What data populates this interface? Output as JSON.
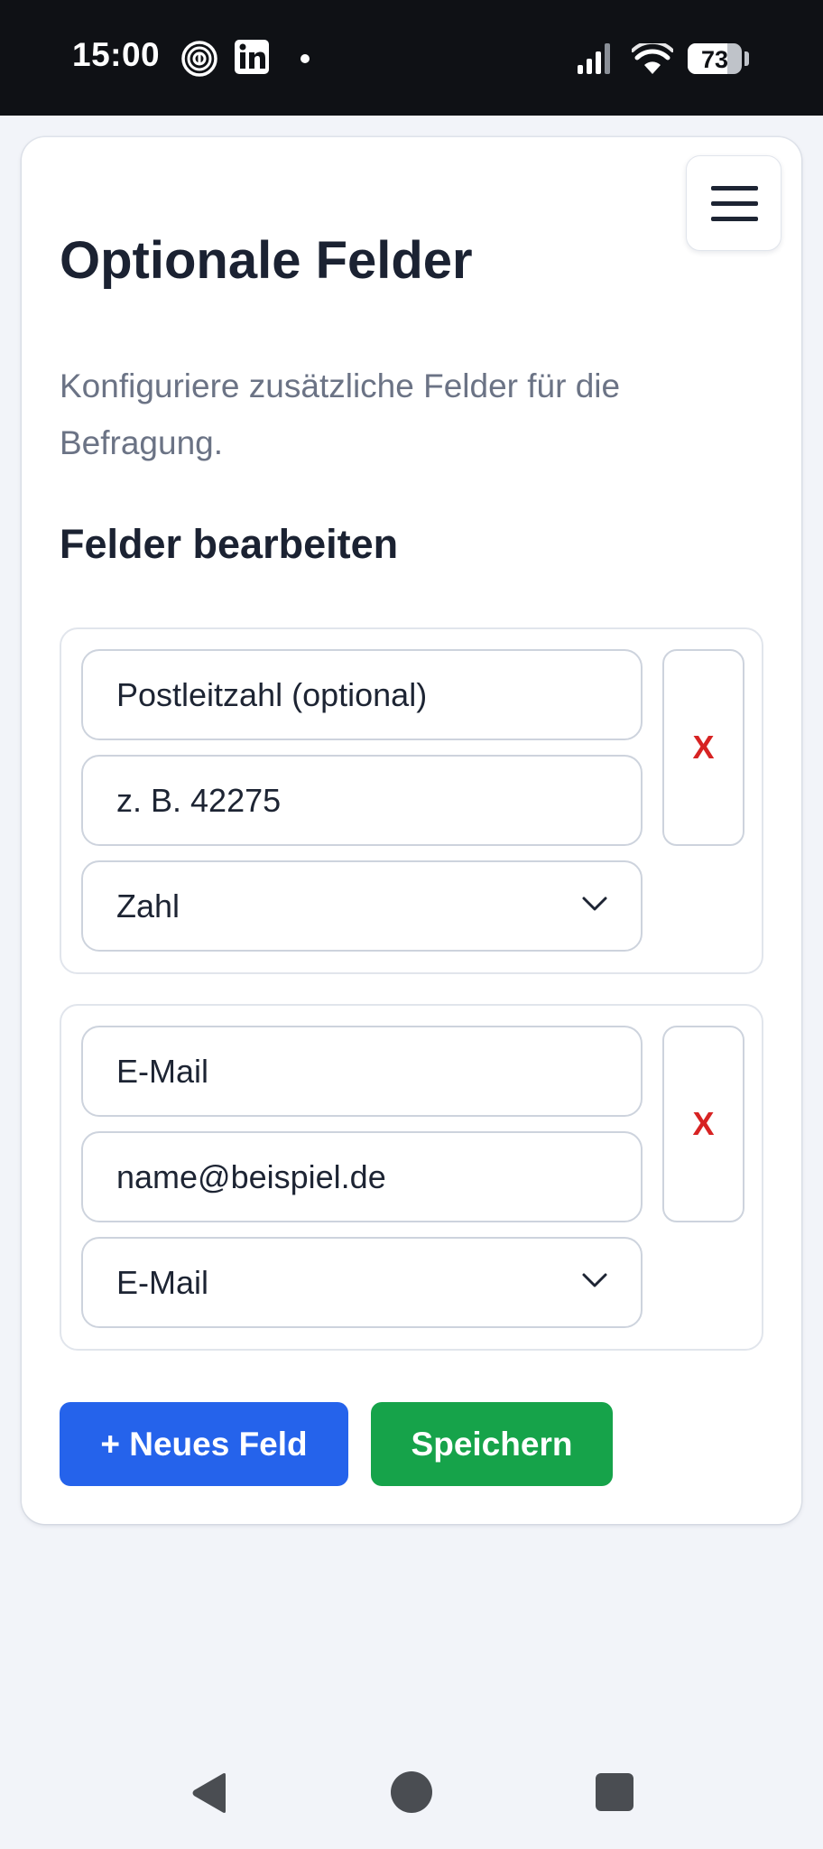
{
  "status_bar": {
    "time": "15:00",
    "icons": [
      "fingerprint-app-icon",
      "linkedin-icon",
      "notification-dot",
      "signal-icon",
      "wifi-icon",
      "battery-icon"
    ],
    "battery": {
      "text": "73",
      "level": 0.73
    }
  },
  "header": {
    "menu_icon": "hamburger-menu-icon"
  },
  "page": {
    "title": "Optionale Felder",
    "subtitle": "Konfiguriere zusätzliche Felder für die Befragung.",
    "section_title": "Felder bearbeiten"
  },
  "fields": [
    {
      "label": "Postleitzahl (optional)",
      "placeholder": "z. B. 42275",
      "type": "Zahl",
      "remove_label": "X"
    },
    {
      "label": "E-Mail",
      "placeholder": "name@beispiel.de",
      "type": "E-Mail",
      "remove_label": "X"
    }
  ],
  "actions": {
    "add_label": "+ Neues Feld",
    "save_label": "Speichern"
  },
  "colors": {
    "primary": "#2563eb",
    "success": "#16a34a",
    "danger": "#d72323",
    "text": "#1b2232",
    "muted": "#6b7385"
  },
  "nav_bar": {
    "icons": [
      "back-icon",
      "home-icon",
      "recents-icon"
    ]
  }
}
